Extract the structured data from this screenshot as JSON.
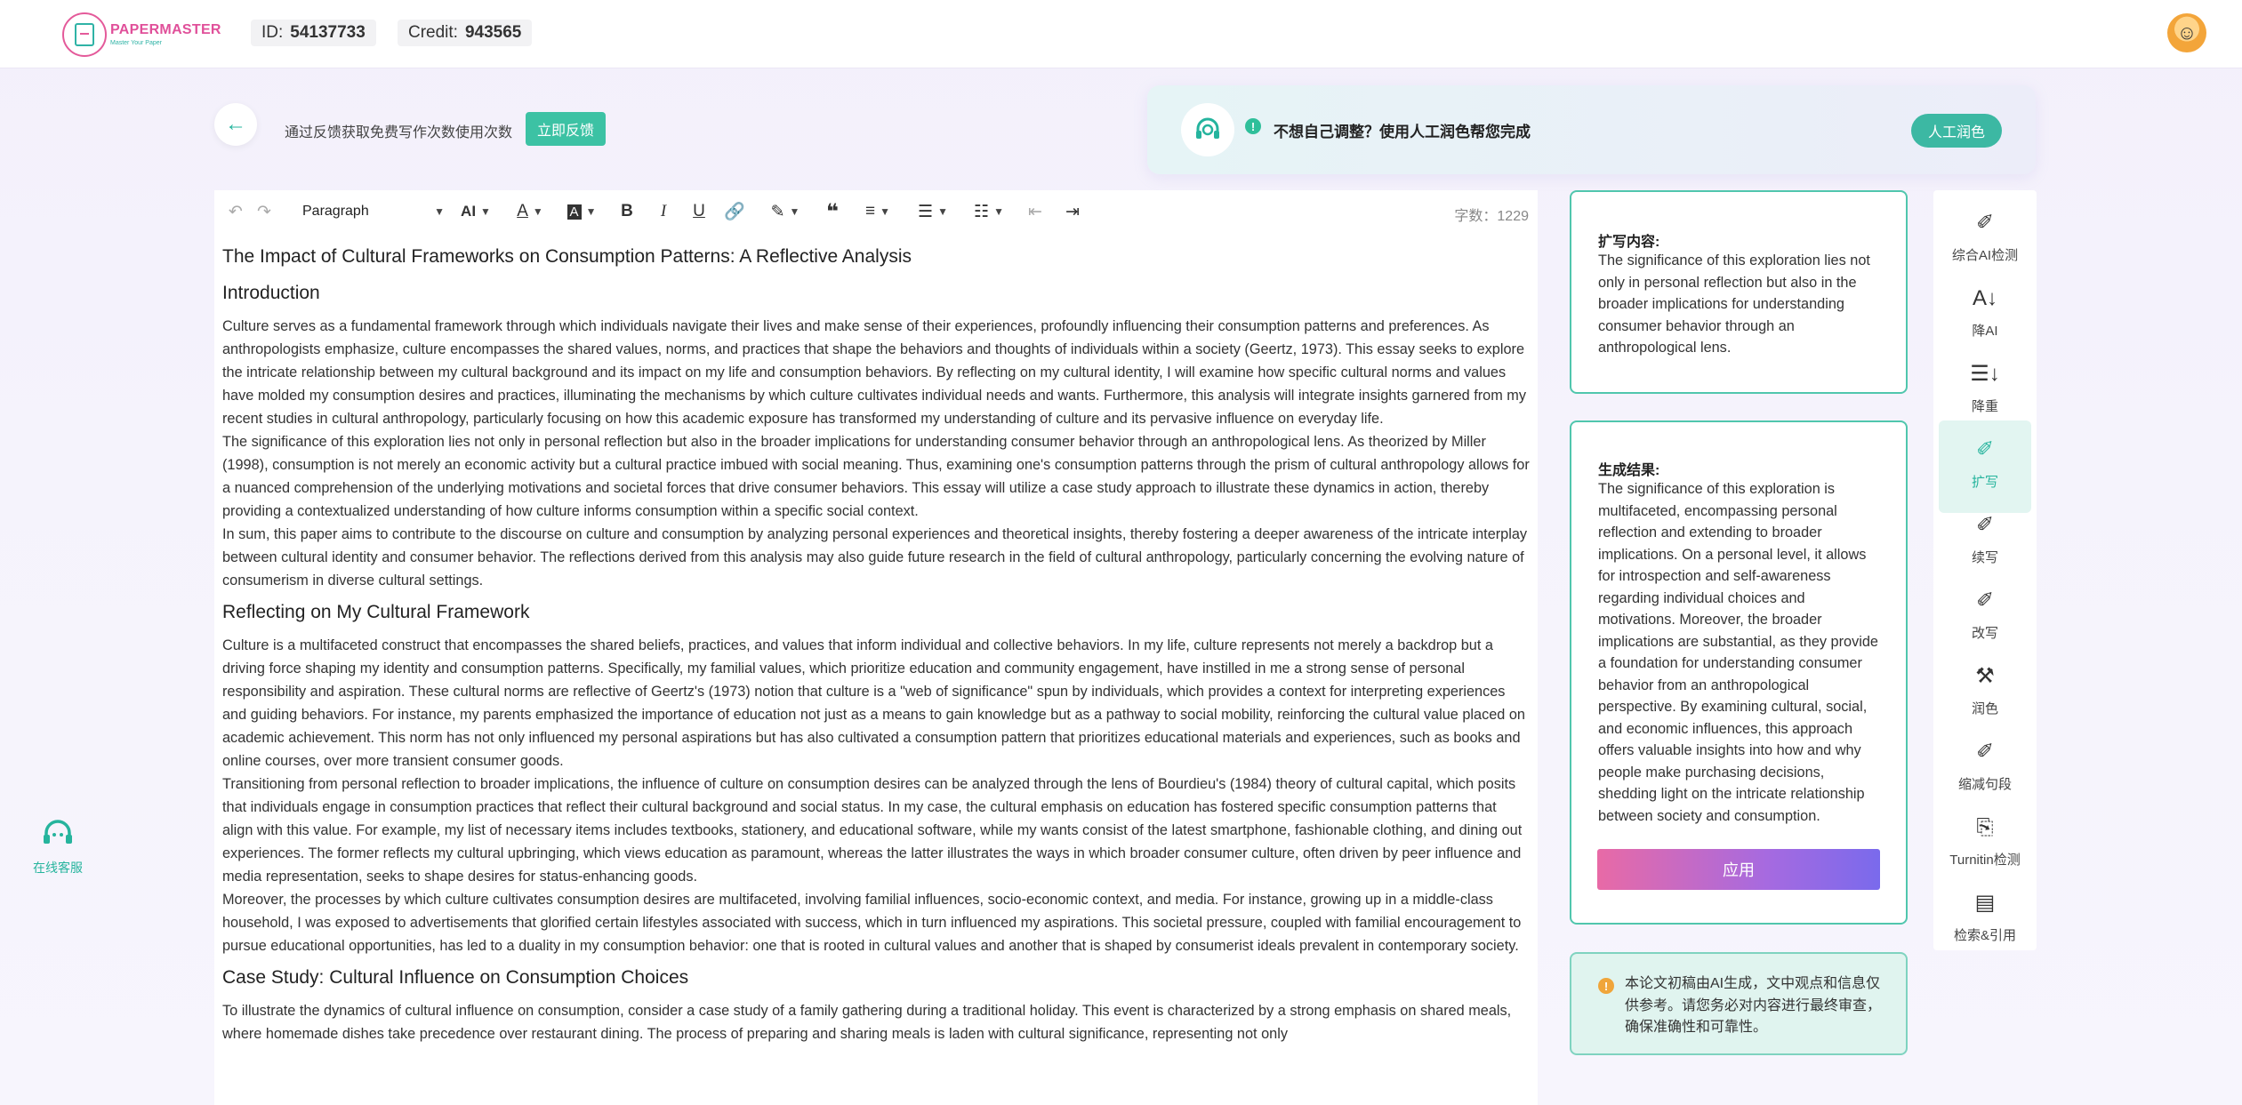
{
  "header": {
    "logo_name": "PAPERMASTER",
    "logo_tagline": "Master Your Paper",
    "id_label": "ID:",
    "id_value": "54137733",
    "credit_label": "Credit:",
    "credit_value": "943565"
  },
  "notice": {
    "feedback_text": "通过反馈获取免费写作次数使用次数",
    "feedback_button": "立即反馈",
    "promo_text": "不想自己调整？使用人工润色帮您完成",
    "promo_button": "人工润色"
  },
  "toolbar": {
    "paragraph_select": "Paragraph",
    "word_count": "字数：1229"
  },
  "document": {
    "title": "The Impact of Cultural Frameworks on Consumption Patterns: A Reflective Analysis",
    "sections": [
      {
        "heading": "Introduction",
        "paragraphs": [
          "Culture serves as a fundamental framework through which individuals navigate their lives and make sense of their experiences, profoundly influencing their consumption patterns and preferences. As anthropologists emphasize, culture encompasses the shared values, norms, and practices that shape the behaviors and thoughts of individuals within a society (Geertz, 1973). This essay seeks to explore the intricate relationship between my cultural background and its impact on my life and consumption behaviors. By reflecting on my cultural identity, I will examine how specific cultural norms and values have molded my consumption desires and practices, illuminating the mechanisms by which culture cultivates individual needs and wants. Furthermore, this analysis will integrate insights garnered from my recent studies in cultural anthropology, particularly focusing on how this academic exposure has transformed my understanding of culture and its pervasive influence on everyday life.",
          "The significance of this exploration lies not only in personal reflection but also in the broader implications for understanding consumer behavior through an anthropological lens. As theorized by Miller (1998), consumption is not merely an economic activity but a cultural practice imbued with social meaning. Thus, examining one's consumption patterns through the prism of cultural anthropology allows for a nuanced comprehension of the underlying motivations and societal forces that drive consumer behaviors. This essay will utilize a case study approach to illustrate these dynamics in action, thereby providing a contextualized understanding of how culture informs consumption within a specific social context.",
          "In sum, this paper aims to contribute to the discourse on culture and consumption by analyzing personal experiences and theoretical insights, thereby fostering a deeper awareness of the intricate interplay between cultural identity and consumer behavior. The reflections derived from this analysis may also guide future research in the field of cultural anthropology, particularly concerning the evolving nature of consumerism in diverse cultural settings."
        ]
      },
      {
        "heading": "Reflecting on My Cultural Framework",
        "paragraphs": [
          "Culture is a multifaceted construct that encompasses the shared beliefs, practices, and values that inform individual and collective behaviors. In my life, culture represents not merely a backdrop but a driving force shaping my identity and consumption patterns. Specifically, my familial values, which prioritize education and community engagement, have instilled in me a strong sense of personal responsibility and aspiration. These cultural norms are reflective of Geertz's (1973) notion that culture is a \"web of significance\" spun by individuals, which provides a context for interpreting experiences and guiding behaviors. For instance, my parents emphasized the importance of education not just as a means to gain knowledge but as a pathway to social mobility, reinforcing the cultural value placed on academic achievement. This norm has not only influenced my personal aspirations but has also cultivated a consumption pattern that prioritizes educational materials and experiences, such as books and online courses, over more transient consumer goods.",
          "Transitioning from personal reflection to broader implications, the influence of culture on consumption desires can be analyzed through the lens of Bourdieu's (1984) theory of cultural capital, which posits that individuals engage in consumption practices that reflect their cultural background and social status. In my case, the cultural emphasis on education has fostered specific consumption patterns that align with this value. For example, my list of necessary items includes textbooks, stationery, and educational software, while my wants consist of the latest smartphone, fashionable clothing, and dining out experiences. The former reflects my cultural upbringing, which views education as paramount, whereas the latter illustrates the ways in which broader consumer culture, often driven by peer influence and media representation, seeks to shape desires for status-enhancing goods.",
          "Moreover, the processes by which culture cultivates consumption desires are multifaceted, involving familial influences, socio-economic context, and media. For instance, growing up in a middle-class household, I was exposed to advertisements that glorified certain lifestyles associated with success, which in turn influenced my aspirations. This societal pressure, coupled with familial encouragement to pursue educational opportunities, has led to a duality in my consumption behavior: one that is rooted in cultural values and another that is shaped by consumerist ideals prevalent in contemporary society."
        ]
      },
      {
        "heading": "Case Study: Cultural Influence on Consumption Choices",
        "paragraphs": [
          "To illustrate the dynamics of cultural influence on consumption, consider a case study of a family gathering during a traditional holiday. This event is characterized by a strong emphasis on shared meals, where homemade dishes take precedence over restaurant dining. The process of preparing and sharing meals is laden with cultural significance, representing not only"
        ]
      }
    ]
  },
  "expand_panel": {
    "title": "扩写内容:",
    "text": "The significance of this exploration lies not only in personal reflection but also in the broader implications for understanding consumer behavior through an anthropological lens."
  },
  "result_panel": {
    "title": "生成结果:",
    "text": "The significance of this exploration is multifaceted, encompassing personal reflection and extending to broader implications. On a personal level, it allows for introspection and self-awareness regarding individual choices and motivations. Moreover, the broader implications are substantial, as they provide a foundation for understanding consumer behavior from an anthropological perspective. By examining cultural, social, and economic influences, this approach offers valuable insights into how and why people make purchasing decisions, shedding light on the intricate relationship between society and consumption.",
    "apply_button": "应用"
  },
  "warning": {
    "text": "本论文初稿由AI生成，文中观点和信息仅供参考。请您务必对内容进行最终审查，确保准确性和可靠性。"
  },
  "service": {
    "label": "在线客服"
  },
  "side_menu": [
    {
      "label": "综合AI检测",
      "icon": "pen-icon",
      "active": false
    },
    {
      "label": "降AI",
      "icon": "sort-ai-icon",
      "active": false
    },
    {
      "label": "降重",
      "icon": "sort-down-icon",
      "active": false
    },
    {
      "label": "扩写",
      "icon": "pen-icon",
      "active": true
    },
    {
      "label": "续写",
      "icon": "pen-icon",
      "active": false
    },
    {
      "label": "改写",
      "icon": "pen-icon",
      "active": false
    },
    {
      "label": "润色",
      "icon": "magic-wand-icon",
      "active": false
    },
    {
      "label": "缩减句段",
      "icon": "pen-icon",
      "active": false
    },
    {
      "label": "Turnitin检测",
      "icon": "doc-icon",
      "active": false
    },
    {
      "label": "检索&引用",
      "icon": "quote-icon",
      "active": false
    }
  ],
  "colors": {
    "accent": "#26b49d",
    "brand_pink": "#e0509a",
    "panel_border": "#50c6ad",
    "apply_gradient_start": "#e86aa6",
    "apply_gradient_end": "#7a6aec"
  }
}
